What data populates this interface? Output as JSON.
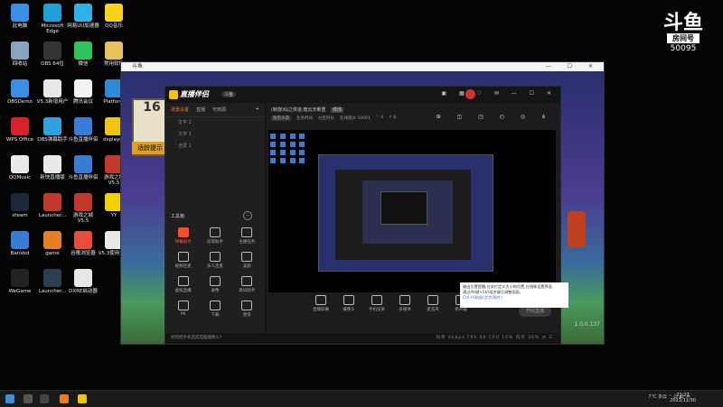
{
  "desktop": {
    "icons": [
      {
        "label": "此电脑",
        "color": "#3a8ee6"
      },
      {
        "label": "Microsoft Edge",
        "color": "#1fa0d8"
      },
      {
        "label": "网易UU加速器",
        "color": "#2fb0e6"
      },
      {
        "label": "QQ音乐",
        "color": "#f7d31e"
      },
      {
        "label": "回收站",
        "color": "#8aa4c0"
      },
      {
        "label": "OBS 64位",
        "color": "#333333"
      },
      {
        "label": "微信",
        "color": "#2ec35b"
      },
      {
        "label": "常用软件",
        "color": "#e5c35b"
      },
      {
        "label": "OBSDemo",
        "color": "#3a8ee6"
      },
      {
        "label": "V5.3新增用户",
        "color": "#e8e8e8"
      },
      {
        "label": "腾讯会议",
        "color": "#f2f2f2"
      },
      {
        "label": "Platform",
        "color": "#2e8bd6"
      },
      {
        "label": "WPS Office",
        "color": "#d7222c"
      },
      {
        "label": "OBS弹幕助手",
        "color": "#2fa0e0"
      },
      {
        "label": "斗鱼直播伴侣",
        "color": "#3a7bd5"
      },
      {
        "label": "dsplayer",
        "color": "#f1c40f"
      },
      {
        "label": "QQMusic",
        "color": "#e8e8e8"
      },
      {
        "label": "新快直播版",
        "color": "#e8e8e8"
      },
      {
        "label": "斗鱼直播伴侣",
        "color": "#3a7bd5"
      },
      {
        "label": "游戏之城 V5.5",
        "color": "#c0392b"
      },
      {
        "label": "steam",
        "color": "#1b2838"
      },
      {
        "label": "Launcher...",
        "color": "#c0392b"
      },
      {
        "label": "游戏之城 V5.5",
        "color": "#c0392b"
      },
      {
        "label": "YY",
        "color": "#f5d000"
      },
      {
        "label": "BanVed",
        "color": "#3a7bd5"
      },
      {
        "label": "game",
        "color": "#e67e22"
      },
      {
        "label": "谷歌浏览器",
        "color": "#e74c3c"
      },
      {
        "label": "V5.3使用说明",
        "color": "#e8e8e8"
      },
      {
        "label": "WeGame",
        "color": "#222222"
      },
      {
        "label": "Launcher...",
        "color": "#2c3e50"
      },
      {
        "label": "DXRE启动器",
        "color": "#e8e8e8"
      }
    ]
  },
  "logo": {
    "mark": "斗鱼",
    "room_label": "房间号",
    "room_number": "50095"
  },
  "game_window": {
    "title": "斗鱼",
    "controls": "— ☐ ✕",
    "panel_text": "16",
    "panel_caption": "适龄提示",
    "version": "1.0.0.137"
  },
  "app": {
    "brand": "直播伴侣",
    "version_badge": "斗鱼",
    "window_controls": "▣ ▦ ♡ ✉ — ☐ ✕",
    "tabs": [
      "场景设置",
      "直播",
      "可用源"
    ],
    "add_tab": "+",
    "scenes": [
      "文字 2",
      "文字 1",
      "全屏 1"
    ],
    "tools_title": "工具箱",
    "tools_more": "···",
    "tools": [
      {
        "label": "弹幕助手",
        "hot": true
      },
      {
        "label": "房管助手",
        "hot": false
      },
      {
        "label": "主播任务",
        "hot": false
      },
      {
        "label": "视频连麦",
        "hot": false
      },
      {
        "label": "多人连麦",
        "hot": false
      },
      {
        "label": "美颜",
        "hot": false
      },
      {
        "label": "虚拟直播",
        "hot": false
      },
      {
        "label": "录像",
        "hot": false
      },
      {
        "label": "歌词助手",
        "hot": false
      },
      {
        "label": "PK",
        "hot": false
      },
      {
        "label": "下载",
        "hot": false
      },
      {
        "label": "更多",
        "hot": false
      }
    ],
    "room_title": "(斡旋)仙之侠道,暗云天断重",
    "room_tag": "修改",
    "category": "魔兽争霸",
    "sub_items": [
      "任务时间",
      "分区时长",
      "在线观众 50091",
      "♡ 4",
      "↑ 8"
    ],
    "right_icons": "⊞ ◫ ◳ ◴ ◎ ⋔",
    "bottom_buttons": [
      "直播屏幕",
      "摄像头",
      "手机投屏",
      "多媒体",
      "麦克风",
      "扬声器"
    ],
    "start_button": "开始直播",
    "status_prompt": "如何把手机变成电脑摄像头?",
    "status_stats": "码率 0kbps  FPS 60  CPU 15%  内存 36%  ◔  ☰"
  },
  "tooltip": {
    "text": "输出位置提醒,任务栏定义大小和位置,在镜像设置界面",
    "line2": "通过Alt键+Ctrl组合键可调整画面,",
    "link": "Ctrl+V粘贴(文字/图片)"
  },
  "taskbar": {
    "tray_text": "7°C 多云  ⌃  ⊡  🔊 ㊥",
    "time": "21:27",
    "date": "2021/11/30"
  }
}
